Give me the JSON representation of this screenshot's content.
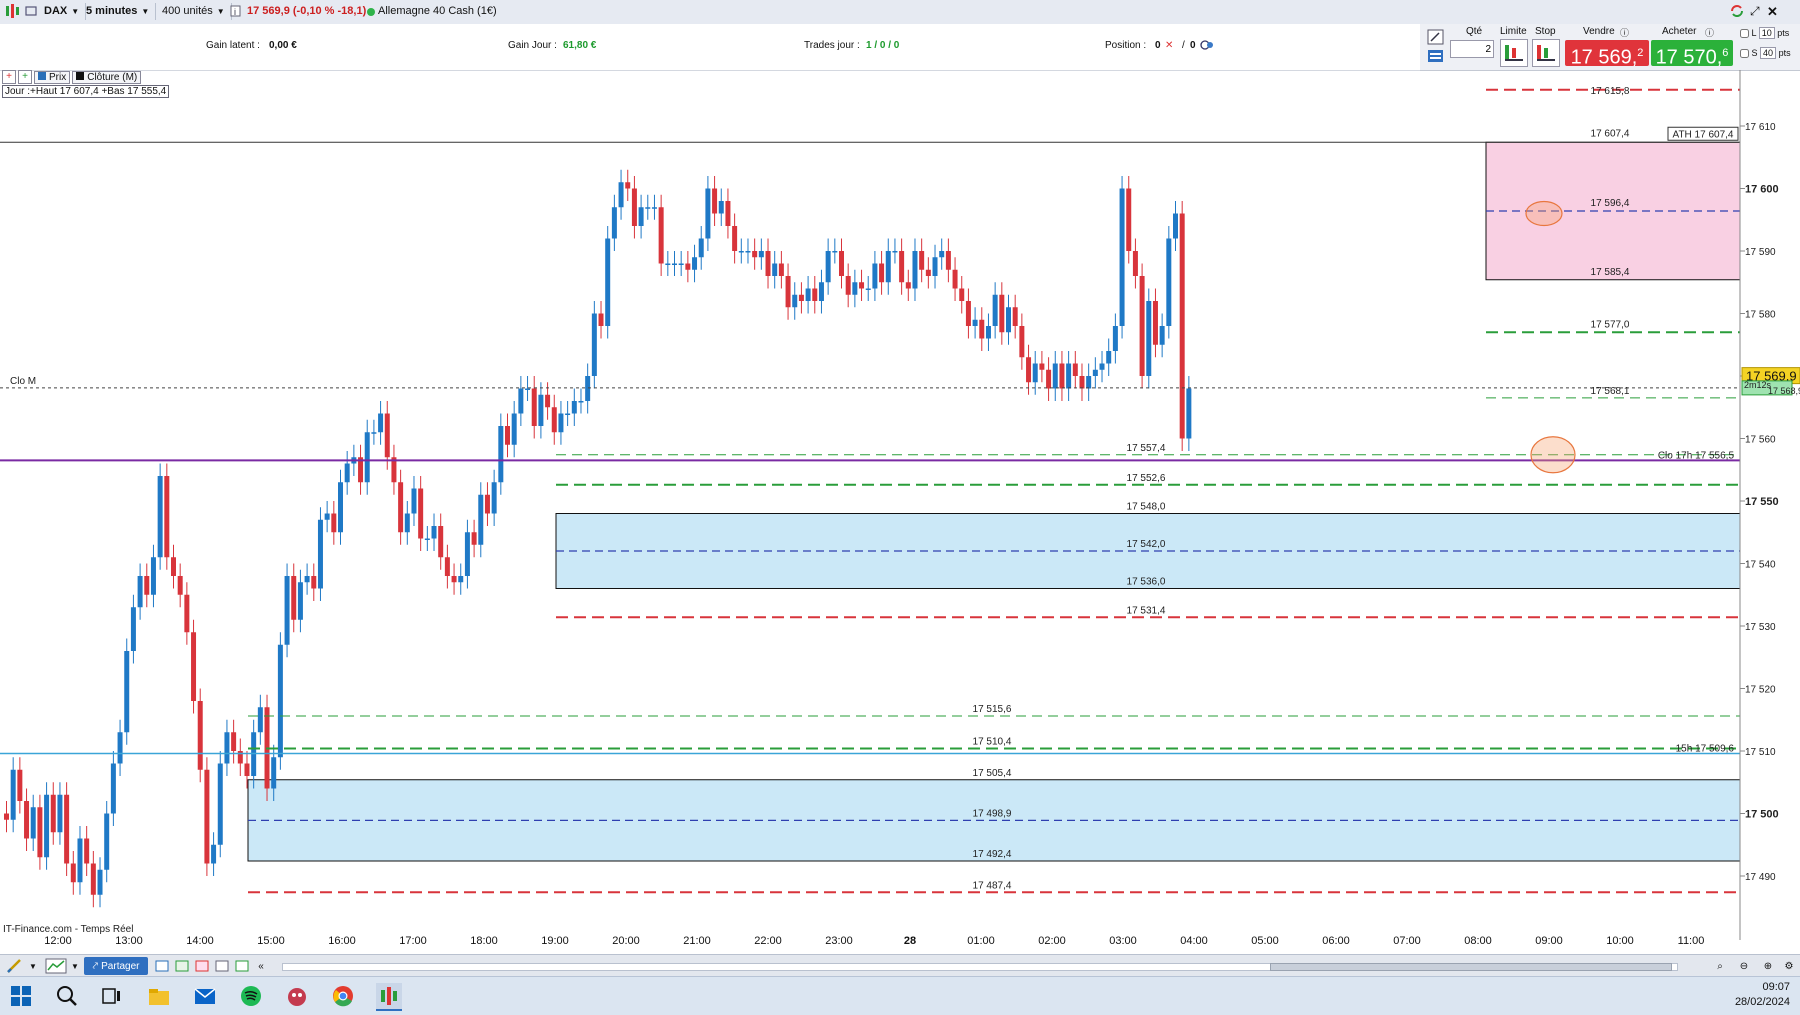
{
  "topbar": {
    "instrument": "DAX",
    "timeframe": "5 minutes",
    "units": "400 unités",
    "quote": "17 569,9 (-0,10 % -18,1)",
    "market": "Allemagne 40 Cash (1€)"
  },
  "info": {
    "gain_latent_label": "Gain latent :",
    "gain_latent_value": "0,00 €",
    "gain_jour_label": "Gain Jour :",
    "gain_jour_value": "61,80 €",
    "trades_label": "Trades jour :",
    "trades_value": "1 / 0 / 0",
    "position_label": "Position :",
    "position_value": "0",
    "position_value2": "0"
  },
  "order_panel": {
    "qty_label": "Qté",
    "qty_value": "2",
    "limit_label": "Limite",
    "stop_label": "Stop",
    "sell_label": "Vendre",
    "buy_label": "Acheter",
    "sell_price": "17 569,",
    "sell_price_sup": "2",
    "buy_price": "17 570,",
    "buy_price_sup": "6",
    "l_label": "L",
    "l_value": "10",
    "s_label": "S",
    "s_value": "40",
    "pts": "pts",
    "colors": {
      "sell": "#e0343b",
      "buy": "#2bb13a"
    }
  },
  "legend": {
    "prix": "Prix",
    "cloture": "Clôture (M)",
    "jour": "Jour :+Haut 17 607,4 +Bas 17 555,4"
  },
  "chart_data": {
    "type": "candlestick",
    "price_axis": [
      "17 610",
      "17 600",
      "17 590",
      "17 580",
      "17 570",
      "17 560",
      "17 550",
      "17 540",
      "17 530",
      "17 520",
      "17 510",
      "17 500",
      "17 490"
    ],
    "ylim": [
      17482.5,
      17616
    ],
    "time_axis": [
      "12:00",
      "13:00",
      "14:00",
      "15:00",
      "16:00",
      "17:00",
      "18:00",
      "19:00",
      "20:00",
      "21:00",
      "22:00",
      "23:00",
      "28",
      "01:00",
      "02:00",
      "03:00",
      "04:00",
      "05:00",
      "06:00",
      "07:00",
      "08:00",
      "09:00",
      "10:00",
      "11:00"
    ],
    "current_price": "17 569,9",
    "countdown": "2m12s",
    "countdown_price": "17 568,9",
    "clo_m_label": "Clo M",
    "source": "IT-Finance.com - Temps Réel",
    "levels": [
      {
        "label": "17 615,8",
        "value": 17615.8
      },
      {
        "label": "17 607,4",
        "value": 17607.4
      },
      {
        "label": "ATH 17 607,4",
        "value": 17607.4
      },
      {
        "label": "17 596,4",
        "value": 17596.4
      },
      {
        "label": "17 585,4",
        "value": 17585.4
      },
      {
        "label": "17 577,0",
        "value": 17577.0
      },
      {
        "label": "17 568,1",
        "value": 17568.1
      },
      {
        "label": "17 557,4",
        "value": 17557.4
      },
      {
        "label": "Clo 17h 17 556,5",
        "value": 17556.5
      },
      {
        "label": "17 552,6",
        "value": 17552.6
      },
      {
        "label": "17 548,0",
        "value": 17548.0
      },
      {
        "label": "17 542,0",
        "value": 17542.0
      },
      {
        "label": "17 536,0",
        "value": 17536.0
      },
      {
        "label": "17 531,4",
        "value": 17531.4
      },
      {
        "label": "17 515,6",
        "value": 17515.6
      },
      {
        "label": "17 510,4",
        "value": 17510.4
      },
      {
        "label": "15h 17 509,6",
        "value": 17509.6
      },
      {
        "label": "17 505,4",
        "value": 17505.4
      },
      {
        "label": "17 498,9",
        "value": 17498.9
      },
      {
        "label": "17 492,4",
        "value": 17492.4
      },
      {
        "label": "17 487,4",
        "value": 17487.4
      }
    ],
    "closes": [
      17499,
      17507,
      17502,
      17496,
      17501,
      17493,
      17503,
      17497,
      17503,
      17492,
      17489,
      17496,
      17492,
      17487,
      17491,
      17500,
      17508,
      17513,
      17526,
      17533,
      17538,
      17535,
      17541,
      17554,
      17541,
      17538,
      17535,
      17529,
      17518,
      17507,
      17492,
      17495,
      17508,
      17513,
      17510,
      17508,
      17506,
      17513,
      17517,
      17504,
      17509,
      17527,
      17538,
      17531,
      17537,
      17538,
      17536,
      17547,
      17548,
      17545,
      17553,
      17556,
      17557,
      17553,
      17561,
      17561,
      17564,
      17557,
      17553,
      17545,
      17548,
      17552,
      17544,
      17544,
      17546,
      17541,
      17538,
      17537,
      17538,
      17545,
      17543,
      17551,
      17548,
      17553,
      17562,
      17559,
      17564,
      17568,
      17568,
      17562,
      17567,
      17565,
      17561,
      17564,
      17564,
      17566,
      17566,
      17570,
      17580,
      17578,
      17592,
      17597,
      17601,
      17600,
      17594,
      17597,
      17597,
      17597,
      17588,
      17588,
      17588,
      17588,
      17587,
      17589,
      17592,
      17600,
      17596,
      17598,
      17594,
      17590,
      17590,
      17590,
      17589,
      17590,
      17586,
      17588,
      17586,
      17581,
      17583,
      17582,
      17584,
      17582,
      17585,
      17590,
      17590,
      17586,
      17583,
      17585,
      17584,
      17584,
      17588,
      17585,
      17590,
      17590,
      17585,
      17584,
      17590,
      17587,
      17586,
      17589,
      17590,
      17587,
      17584,
      17582,
      17578,
      17579,
      17576,
      17578,
      17583,
      17577,
      17581,
      17578,
      17573,
      17569,
      17572,
      17571,
      17568,
      17572,
      17568,
      17572,
      17570,
      17568,
      17570,
      17571,
      17572,
      17574,
      17578,
      17600,
      17590,
      17586,
      17570,
      17582,
      17575,
      17578,
      17592,
      17596,
      17560,
      17568
    ]
  }
}
